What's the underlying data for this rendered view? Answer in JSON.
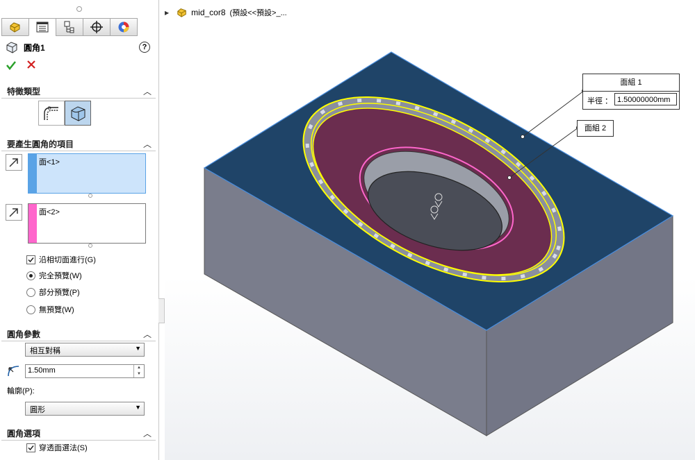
{
  "panel": {
    "title": "圓角1",
    "help": "?",
    "sections": {
      "feature_type": "特徵類型",
      "items": "要產生圓角的項目",
      "params": "圓角參數",
      "options": "圓角選項"
    },
    "selection1": "面<1>",
    "selection2": "面<2>",
    "options_list": {
      "tangent_propagation": "沿相切面進行(G)",
      "full_preview": "完全預覽(W)",
      "partial_preview": "部分預覽(P)",
      "no_preview": "無預覽(W)"
    },
    "symmetry_value": "相互對稱",
    "radius_value": "1.50mm",
    "profile_label": "輪廓(P):",
    "profile_value": "圓形",
    "select_through_faces": "穿透面選法(S)"
  },
  "tree": {
    "model_name": "mid_cor8",
    "config": "(預設<<預設>_..."
  },
  "callouts": {
    "face_set1": "面組 1",
    "radius_label": "半徑 ：",
    "radius_value": "1.50000000mm",
    "face_set2": "面組 2"
  },
  "colors": {
    "top_face": "#1f4468",
    "side_face": "#7a7d8c",
    "fillet_face": "#6b2d4f",
    "face_set1_highlight": "#ffff00",
    "face_set2_highlight": "#ff66cc",
    "ok": "#2aa02a",
    "cancel": "#d22020"
  },
  "icons": [
    "part-icon",
    "feature-manager-icon",
    "property-manager-icon",
    "config-manager-icon",
    "dimxpert-icon",
    "display-manager-icon",
    "help-icon",
    "ok-icon",
    "cancel-icon",
    "constant-size-fillet-icon",
    "face-fillet-icon",
    "radius-icon"
  ]
}
